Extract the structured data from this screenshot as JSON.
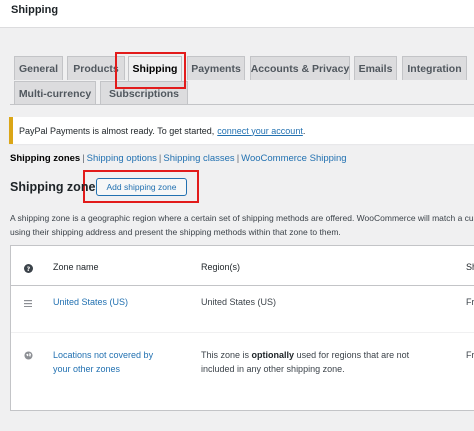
{
  "page": {
    "title": "Shipping"
  },
  "tabs": [
    {
      "label": "General"
    },
    {
      "label": "Products"
    },
    {
      "label": "Shipping"
    },
    {
      "label": "Payments"
    },
    {
      "label": "Accounts & Privacy"
    },
    {
      "label": "Emails"
    },
    {
      "label": "Integration"
    },
    {
      "label": "Multi-currency"
    },
    {
      "label": "Subscriptions"
    }
  ],
  "active_tab": "Shipping",
  "notice": {
    "text": "PayPal Payments is almost ready. To get started,",
    "link": "connect your account",
    "after": "."
  },
  "subnav": {
    "items": [
      {
        "label": "Shipping zones"
      },
      {
        "label": "Shipping options"
      },
      {
        "label": "Shipping classes"
      },
      {
        "label": "WooCommerce Shipping"
      }
    ],
    "separator": "|"
  },
  "zones": {
    "title": "Shipping zones",
    "add_button": "Add shipping zone",
    "description_line1": "A shipping zone is a geographic region where a certain set of shipping methods are offered. WooCommerce will match a customer to a single zone",
    "description_line2": "using their shipping address and present the shipping methods within that zone to them.",
    "columns": {
      "name": "Zone name",
      "regions": "Region(s)",
      "methods": "Shipping method(s)"
    },
    "rows": [
      {
        "name": "United States (US)",
        "regions": "United States (US)",
        "methods": "Free shipping"
      },
      {
        "name_line1": "Locations not covered by",
        "name_line2": "your other zones",
        "region_before": "This zone is",
        "region_bold": "optionally",
        "region_after": "used for regions that are not",
        "region_line2": "included in any other shipping zone.",
        "methods": "Free shipping"
      }
    ]
  },
  "colors": {
    "accent": "#2271b1",
    "highlight": "#e21b1b",
    "notice_border": "#dba617"
  }
}
